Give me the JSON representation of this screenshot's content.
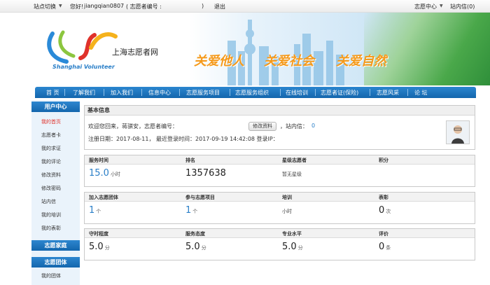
{
  "topbar": {
    "site_switch": "站点切换",
    "greeting": "您好!",
    "username": "jiangqian0807",
    "volunteer_no_label": "( 志愿者编号 :",
    "volunteer_no_close": ")",
    "logout": "退出",
    "volunteer_center": "志愿中心",
    "inbox": "站内信(0)"
  },
  "banner": {
    "logo_cn": "上海志愿者网",
    "logo_en": "Shanghai Volunteer",
    "slogans": [
      "关爱他人",
      "关爱社会",
      "关爱自然"
    ]
  },
  "nav": {
    "items": [
      "首 页",
      "了解我们",
      "加入我们",
      "信息中心",
      "志愿服务项目",
      "志愿服务组织",
      "在线培训",
      "志愿者证(保险)",
      "志愿风采",
      "论 坛"
    ]
  },
  "sidebar": {
    "user_center": "用户中心",
    "user_items": [
      "我的首页",
      "志愿者卡",
      "我的求证",
      "我的评论",
      "修改资料",
      "修改密码",
      "站内信",
      "我的培训",
      "我的表彰"
    ],
    "family": "志愿家庭",
    "group": "志愿团体",
    "group_items": [
      "我的团体"
    ]
  },
  "basic": {
    "title": "基本信息",
    "welcome": "欢迎您回来，蒋骐安，志愿者编号：",
    "edit_button": "修改资料",
    "inbox_label": "，站内信：",
    "inbox_count": "0",
    "register_line": "注册日期：2017-08-11，   最近登录时间：2017-09-19 14:42:08   登录IP："
  },
  "stats1": {
    "labels": [
      "服务时间",
      "排名",
      "星级志愿者",
      "积分"
    ],
    "service_time": "15.0",
    "service_time_unit": "小时",
    "rank": "1357638",
    "star": "暂无星级"
  },
  "stats2": {
    "labels": [
      "加入志愿团体",
      "参与志愿项目",
      "培训",
      "表彰"
    ],
    "groups": "1",
    "groups_unit": "个",
    "projects": "1",
    "projects_unit": "个",
    "training_unit": "小时",
    "awards": "0",
    "awards_unit": "次"
  },
  "stats3": {
    "labels": [
      "守时程度",
      "服务态度",
      "专业水平",
      "评价"
    ],
    "punctuality": "5.0",
    "attitude": "5.0",
    "professional": "5.0",
    "unit": "分",
    "reviews": "0",
    "reviews_unit": "条"
  },
  "colors": {
    "nav_blue": "#1a72b9",
    "accent_blue": "#2a7fc8",
    "active_red": "#e0322b",
    "slogan_orange": "#f59a1c"
  }
}
